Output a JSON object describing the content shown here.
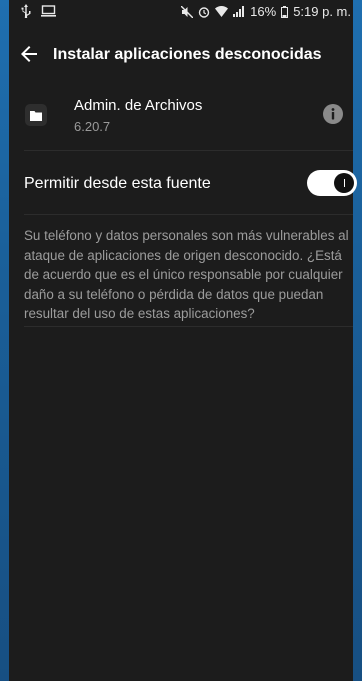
{
  "status_bar": {
    "battery": "16%",
    "time": "5:19 p. m."
  },
  "app_bar": {
    "title": "Instalar aplicaciones desconocidas",
    "back_icon": "arrow-left-icon"
  },
  "app_info": {
    "name": "Admin. de Archivos",
    "version": "6.20.7",
    "icon": "folder-icon",
    "info_icon": "info-icon"
  },
  "setting": {
    "label": "Permitir desde esta fuente",
    "enabled": true
  },
  "warning": {
    "text": "Su teléfono y datos personales son más vulnerables al ataque de aplicaciones de origen desconocido. ¿Está de acuerdo que es el único responsable por cualquier daño a su teléfono o pérdida de datos que puedan resultar del uso de estas aplicaciones?"
  },
  "colors": {
    "background": "#1c1c1c",
    "edge": "#1a5f99",
    "secondary_text": "#9c9c9c"
  }
}
